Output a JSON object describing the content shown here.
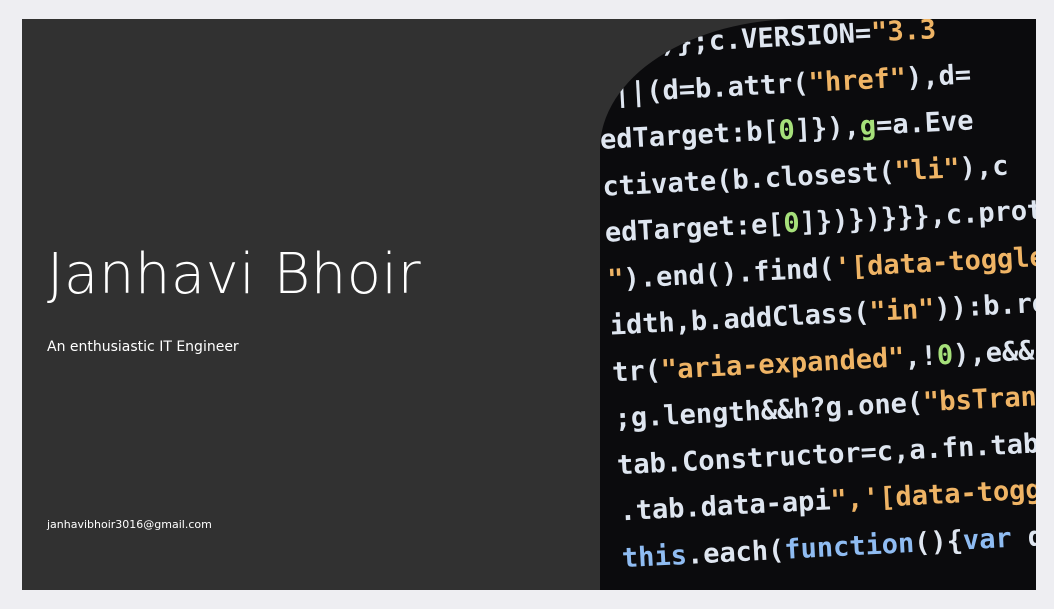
{
  "profile": {
    "name": "Janhavi Bhoir",
    "tagline": "An enthusiastic IT Engineer",
    "email": "janhavibhoir3016@gmail.com"
  },
  "code_image": {
    "lines": [
      [
        {
          "t": "w",
          "s": "  (b)};c.VERSION="
        },
        {
          "t": "s",
          "s": "\"3.3"
        }
      ],
      [
        {
          "t": "w",
          "s": " ||(d=b.attr("
        },
        {
          "t": "s",
          "s": "\"href\""
        },
        {
          "t": "w",
          "s": "),d="
        }
      ],
      [
        {
          "t": "w",
          "s": "edTarget:b["
        },
        {
          "t": "g",
          "s": "0"
        },
        {
          "t": "w",
          "s": "]}),"
        },
        {
          "t": "g",
          "s": "g"
        },
        {
          "t": "w",
          "s": "=a.Eve"
        }
      ],
      [
        {
          "t": "w",
          "s": "ctivate(b.closest("
        },
        {
          "t": "s",
          "s": "\"li\""
        },
        {
          "t": "w",
          "s": "),c"
        }
      ],
      [
        {
          "t": "w",
          "s": "edTarget:e["
        },
        {
          "t": "g",
          "s": "0"
        },
        {
          "t": "w",
          "s": "]})})}}},c.prot"
        }
      ],
      [
        {
          "t": "s",
          "s": "\""
        },
        {
          "t": "w",
          "s": ").end().find("
        },
        {
          "t": "s",
          "s": "'[data-toggle"
        }
      ],
      [
        {
          "t": "w",
          "s": "idth,b.addClass("
        },
        {
          "t": "s",
          "s": "\"in\""
        },
        {
          "t": "w",
          "s": ")):b.re"
        }
      ],
      [
        {
          "t": "w",
          "s": "tr("
        },
        {
          "t": "s",
          "s": "\"aria-expanded\""
        },
        {
          "t": "w",
          "s": ",!"
        },
        {
          "t": "g",
          "s": "0"
        },
        {
          "t": "w",
          "s": "),e&&"
        }
      ],
      [
        {
          "t": "w",
          "s": ";g.length&&h?g.one("
        },
        {
          "t": "s",
          "s": "\"bsTrans"
        }
      ],
      [
        {
          "t": "w",
          "s": "tab.Constructor=c,a.fn.tab."
        }
      ],
      [
        {
          "t": "w",
          "s": ".tab.data-api"
        },
        {
          "t": "s",
          "s": "\",'[data-togg"
        }
      ],
      [
        {
          "t": "k",
          "s": "this"
        },
        {
          "t": "w",
          "s": ".each("
        },
        {
          "t": "k",
          "s": "function"
        },
        {
          "t": "w",
          "s": "(){"
        },
        {
          "t": "k",
          "s": "var"
        },
        {
          "t": "w",
          "s": " d="
        }
      ]
    ]
  },
  "colors": {
    "page_background": "#eeeef2",
    "card_background": "#313131",
    "text": "#ffffff",
    "code_background": "#0b0b0d",
    "code_default": "#dfe6f0",
    "code_string": "#efb465",
    "code_keyword": "#8fbcf2",
    "code_number": "#a6e07a"
  }
}
